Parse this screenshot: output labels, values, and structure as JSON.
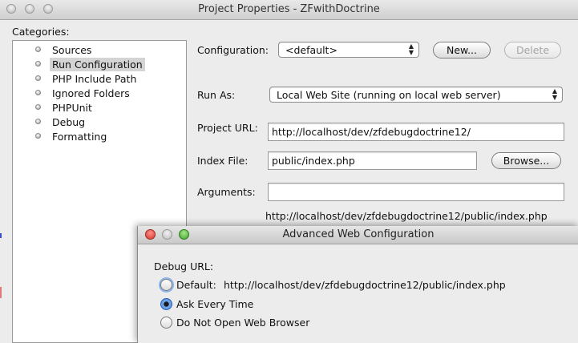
{
  "window": {
    "title": "Project Properties - ZFwithDoctrine"
  },
  "categories": {
    "label": "Categories:",
    "items": [
      {
        "label": "Sources"
      },
      {
        "label": "Run Configuration"
      },
      {
        "label": "PHP Include Path"
      },
      {
        "label": "Ignored Folders"
      },
      {
        "label": "PHPUnit"
      },
      {
        "label": "Debug"
      },
      {
        "label": "Formatting"
      }
    ],
    "selected": "Run Configuration"
  },
  "run_config": {
    "configuration_label": "Configuration:",
    "configuration_value": "<default>",
    "new_button": "New...",
    "delete_button": "Delete",
    "run_as_label": "Run As:",
    "run_as_value": "Local Web Site (running on local web server)",
    "project_url_label": "Project URL:",
    "project_url_value": "http://localhost/dev/zfdebugdoctrine12/",
    "index_file_label": "Index File:",
    "index_file_value": "public/index.php",
    "browse_button": "Browse...",
    "arguments_label": "Arguments:",
    "arguments_value": "",
    "resolved_url": "http://localhost/dev/zfdebugdoctrine12/public/index.php"
  },
  "dialog": {
    "title": "Advanced Web Configuration",
    "debug_url_label": "Debug URL:",
    "options": [
      {
        "label": "Default:",
        "url": "http://localhost/dev/zfdebugdoctrine12/public/index.php",
        "checked": false
      },
      {
        "label": "Ask Every Time",
        "checked": true
      },
      {
        "label": "Do Not Open Web Browser",
        "checked": false
      }
    ]
  }
}
